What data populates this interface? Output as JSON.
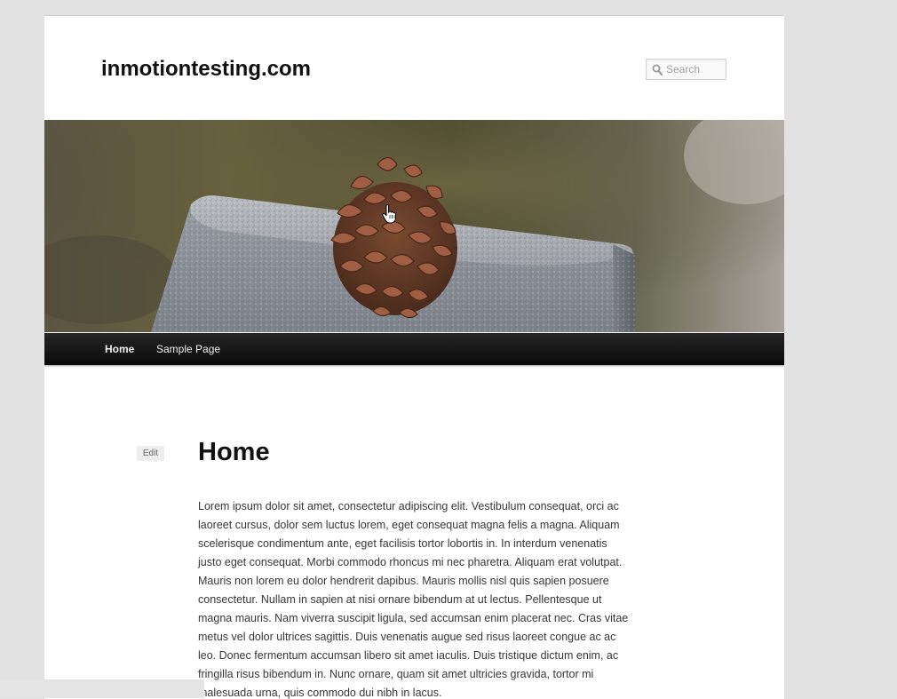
{
  "site": {
    "title": "inmotiontesting.com"
  },
  "search": {
    "placeholder": "Search",
    "icon": "search-icon"
  },
  "header_image": {
    "subject": "pinecone-on-granite"
  },
  "nav": {
    "items": [
      {
        "label": "Home",
        "active": true
      },
      {
        "label": "Sample Page",
        "active": false
      }
    ]
  },
  "entry": {
    "edit_label": "Edit",
    "title": "Home",
    "content": "Lorem ipsum dolor sit amet, consectetur adipiscing elit. Vestibulum consequat, orci ac laoreet cursus, dolor sem luctus lorem, eget consequat magna felis a magna. Aliquam scelerisque condimentum ante, eget facilisis tortor lobortis in. In interdum venenatis justo eget consequat. Morbi commodo rhoncus mi nec pharetra. Aliquam erat volutpat. Mauris non lorem eu dolor hendrerit dapibus. Mauris mollis nisl quis sapien posuere consectetur. Nullam in sapien at nisi ornare bibendum at ut lectus. Pellentesque ut magna mauris. Nam viverra suscipit ligula, sed accumsan enim placerat nec. Cras vitae metus vel dolor ultrices sagittis. Duis venenatis augue sed risus laoreet congue ac ac leo. Donec fermentum accumsan libero sit amet iaculis. Duis tristique dictum enim, ac fringilla risus bibendum in. Nunc ornare, quam sit amet ultricies gravida, tortor mi malesuada urna, quis commodo dui nibh in lacus."
  },
  "colors": {
    "page_bg": "#e2e2e2",
    "content_bg": "#ffffff",
    "nav_bg": "#111111",
    "nav_text": "#eeeeee",
    "title_text": "#111111",
    "body_text": "#373737"
  }
}
